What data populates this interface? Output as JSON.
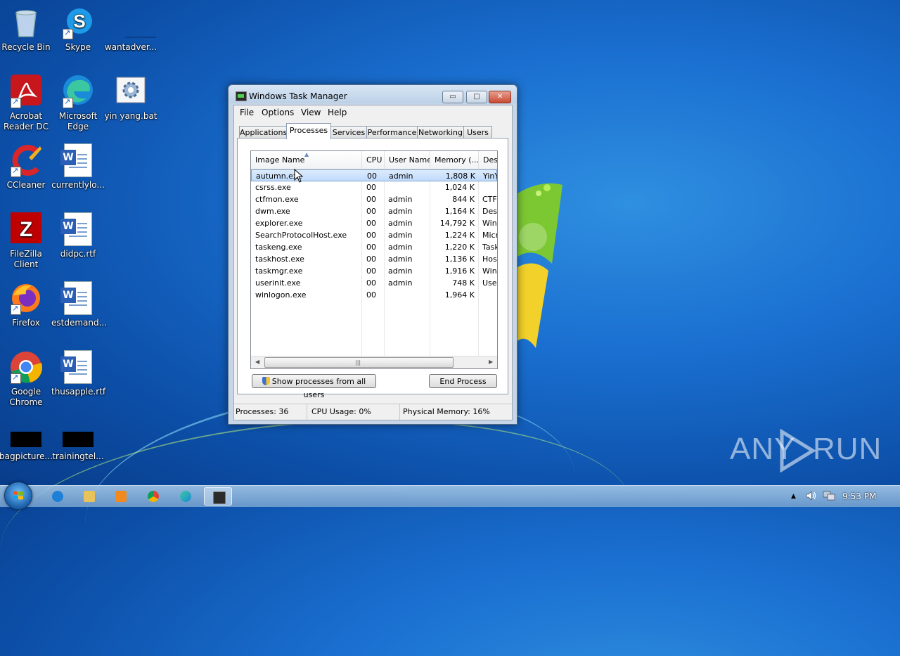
{
  "desktop": {
    "icons": [
      {
        "label": "Recycle Bin"
      },
      {
        "label": "Skype"
      },
      {
        "label": "wantadver..."
      },
      {
        "label": "Acrobat Reader DC"
      },
      {
        "label": "Microsoft Edge"
      },
      {
        "label": "yin yang.bat"
      },
      {
        "label": "CCleaner"
      },
      {
        "label": "currentlylo..."
      },
      {
        "label": "FileZilla Client"
      },
      {
        "label": "didpc.rtf"
      },
      {
        "label": "Firefox"
      },
      {
        "label": "estdemand..."
      },
      {
        "label": "Google Chrome"
      },
      {
        "label": "thusapple.rtf"
      },
      {
        "label": "bagpicture..."
      },
      {
        "label": "trainingtel..."
      }
    ],
    "watermark": {
      "left": "ANY",
      "right": "RUN"
    }
  },
  "window": {
    "title": "Windows Task Manager",
    "controls": {
      "minimize": "▭",
      "maximize": "□",
      "close": "✕"
    },
    "menu": [
      "File",
      "Options",
      "View",
      "Help"
    ],
    "tabs": [
      "Applications",
      "Processes",
      "Services",
      "Performance",
      "Networking",
      "Users"
    ],
    "active_tab": "Processes",
    "columns": [
      "Image Name",
      "CPU",
      "User Name",
      "Memory (...",
      "Desc"
    ],
    "processes": [
      {
        "name": "autumn.exe",
        "cpu": "00",
        "user": "admin",
        "memory": "1,808 K",
        "desc": "YinY",
        "selected": true
      },
      {
        "name": "csrss.exe",
        "cpu": "00",
        "user": "",
        "memory": "1,024 K",
        "desc": ""
      },
      {
        "name": "ctfmon.exe",
        "cpu": "00",
        "user": "admin",
        "memory": "844 K",
        "desc": "CTF"
      },
      {
        "name": "dwm.exe",
        "cpu": "00",
        "user": "admin",
        "memory": "1,164 K",
        "desc": "Desl"
      },
      {
        "name": "explorer.exe",
        "cpu": "00",
        "user": "admin",
        "memory": "14,792 K",
        "desc": "Wind"
      },
      {
        "name": "SearchProtocolHost.exe",
        "cpu": "00",
        "user": "admin",
        "memory": "1,224 K",
        "desc": "Micr"
      },
      {
        "name": "taskeng.exe",
        "cpu": "00",
        "user": "admin",
        "memory": "1,220 K",
        "desc": "Task"
      },
      {
        "name": "taskhost.exe",
        "cpu": "00",
        "user": "admin",
        "memory": "1,136 K",
        "desc": "Host"
      },
      {
        "name": "taskmgr.exe",
        "cpu": "00",
        "user": "admin",
        "memory": "1,916 K",
        "desc": "Wind"
      },
      {
        "name": "userinit.exe",
        "cpu": "00",
        "user": "admin",
        "memory": "748 K",
        "desc": "User"
      },
      {
        "name": "winlogon.exe",
        "cpu": "00",
        "user": "",
        "memory": "1,964 K",
        "desc": ""
      }
    ],
    "show_all_button": "Show processes from all users",
    "end_process_button": "End Process",
    "status": {
      "processes": "Processes: 36",
      "cpu": "CPU Usage: 0%",
      "memory": "Physical Memory: 16%"
    }
  },
  "taskbar": {
    "clock": "9:53 PM",
    "tray_arrow": "▲"
  }
}
